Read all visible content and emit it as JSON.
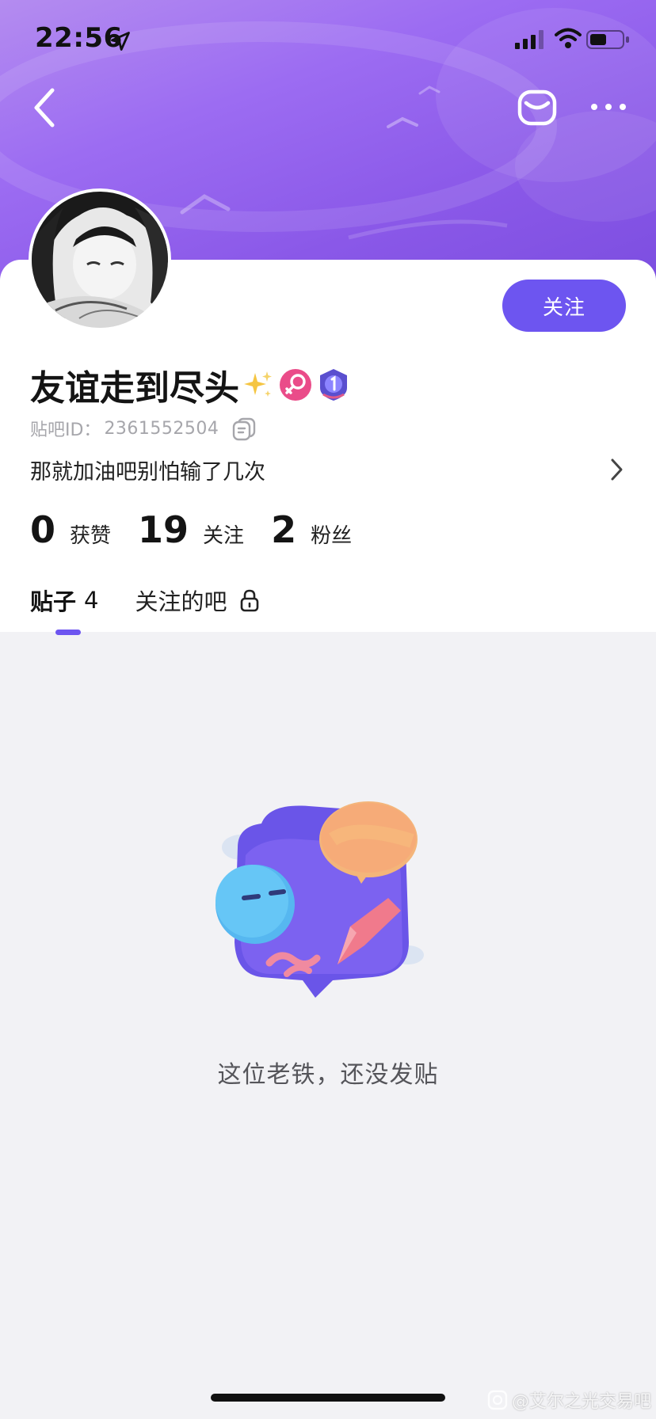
{
  "status_bar": {
    "time": "22:56"
  },
  "profile": {
    "username": "友谊走到尽头",
    "id_label": "贴吧ID：",
    "id_value": "2361552504",
    "bio": "那就加油吧别怕输了几次",
    "follow_button": "关注"
  },
  "stats": [
    {
      "num": "0",
      "label": "获赞"
    },
    {
      "num": "19",
      "label": "关注"
    },
    {
      "num": "2",
      "label": "粉丝"
    }
  ],
  "tabs": [
    {
      "label": "贴子",
      "count": "4"
    },
    {
      "label": "关注的吧"
    }
  ],
  "empty_state": {
    "message": "这位老铁，还没发贴"
  },
  "watermark": "@艾尔之光交易吧",
  "colors": {
    "accent": "#6d55f0",
    "header_gradient_start": "#b48cf0",
    "header_gradient_end": "#7c4ee0",
    "gender_badge": "#ea4c89"
  },
  "icons": {
    "location": "location-arrow-icon",
    "signal": "cellular-signal-icon",
    "wifi": "wifi-icon",
    "battery": "battery-icon",
    "back": "back-chevron-icon",
    "mail": "mail-icon",
    "more": "more-dots-icon",
    "copy": "copy-icon",
    "chevron": "chevron-right-icon",
    "lock": "lock-icon",
    "sparkle": "sparkle-icon",
    "gender": "female-icon",
    "level": "level-badge-icon"
  }
}
